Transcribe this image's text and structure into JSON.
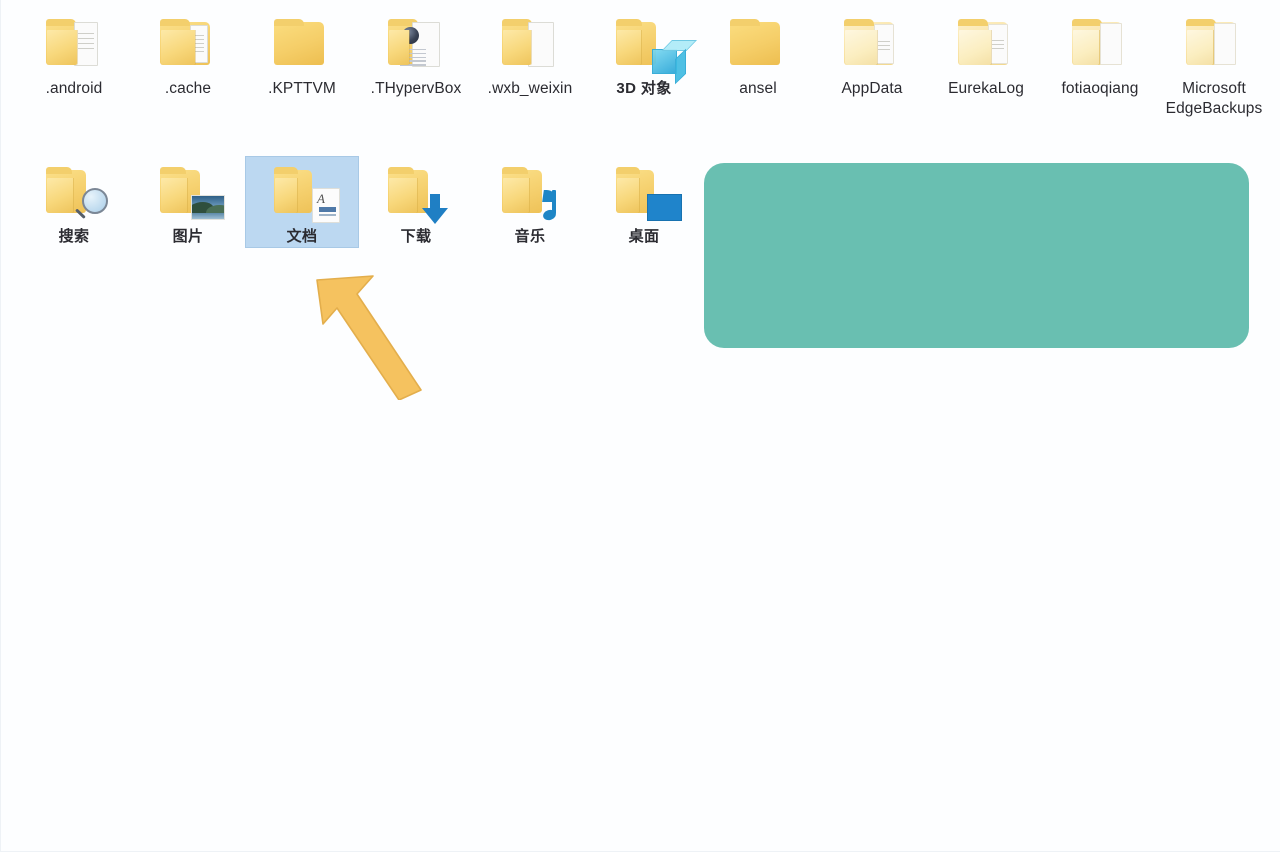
{
  "window": {
    "title": "Windows File Explorer - User Folder Contents",
    "background_color": "#fdfeff"
  },
  "desktop": {
    "rows": [
      {
        "row_index": 1,
        "items": [
          {
            "label": ".android",
            "icon": "folder-with-document-icon",
            "selected": false
          },
          {
            "label": ".cache",
            "icon": "folder-with-document-icon",
            "selected": false
          },
          {
            "label": ".KPTTVM",
            "icon": "folder-icon",
            "selected": false
          },
          {
            "label": ".THypervBox",
            "icon": "folder-with-globe-icon",
            "selected": false
          },
          {
            "label": ".wxb_weixin",
            "icon": "folder-with-document-icon",
            "selected": false
          },
          {
            "label": "3D 对象",
            "icon": "folder-with-cube-icon",
            "selected": false
          },
          {
            "label": "ansel",
            "icon": "folder-icon",
            "selected": false
          },
          {
            "label": "AppData",
            "icon": "folder-with-document-icon",
            "selected": false
          },
          {
            "label": "EurekaLog",
            "icon": "folder-with-document-icon",
            "selected": false
          },
          {
            "label": "fotiaoqiang",
            "icon": "folder-with-document-icon",
            "selected": false
          },
          {
            "label": "Microsoft EdgeBackups",
            "icon": "folder-with-document-icon",
            "selected": false
          }
        ]
      },
      {
        "row_index": 2,
        "items": [
          {
            "label": "搜索",
            "icon": "folder-with-magnifier-icon",
            "selected": false
          },
          {
            "label": "图片",
            "icon": "folder-with-picture-icon",
            "selected": false
          },
          {
            "label": "文档",
            "icon": "folder-with-document-note-icon",
            "selected": true
          },
          {
            "label": "下载",
            "icon": "folder-with-download-arrow-icon",
            "selected": false
          },
          {
            "label": "音乐",
            "icon": "folder-with-music-note-icon",
            "selected": false
          },
          {
            "label": "桌面",
            "icon": "folder-with-monitor-icon",
            "selected": false
          }
        ]
      }
    ],
    "selection": {
      "selected_label": "文档",
      "highlight_fill": "#bcd8f1",
      "highlight_border": "#a8c9e6"
    }
  },
  "annotations": {
    "redaction_block": {
      "name": "green-redaction-block",
      "color": "#69bfb1",
      "shape": "rounded-rectangle",
      "corner_radius_px": 20
    },
    "pointer_arrow": {
      "name": "orange-pointer-arrow",
      "color": "#f5c25f",
      "stroke_color": "#e0ac4a",
      "direction": "up-left",
      "points_at": "文档"
    }
  },
  "colors": {
    "folder_yellow": "#f6d271",
    "folder_pale": "#fbeec0",
    "label_text": "#2b2b31",
    "accent_blue": "#1f84cb",
    "selection_blue": "#bcd8f1",
    "redaction_green": "#69bfb1",
    "arrow_orange": "#f5c25f"
  }
}
